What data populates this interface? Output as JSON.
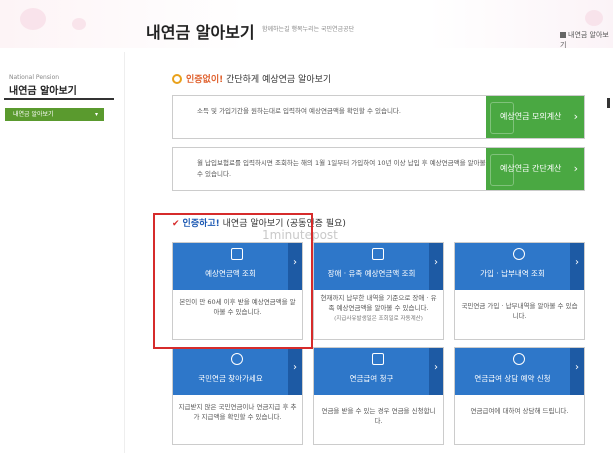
{
  "header": {
    "title": "내연금 알아보기",
    "subtitle": "함께하는길 행복누리는 국민연금공단",
    "util_link": "내연금 알아보기"
  },
  "sidebar": {
    "eng_label": "National Pension",
    "title": "내연금 알아보기",
    "menu_button": "내연금 알아보기"
  },
  "section_no_auth": {
    "heading_strong": "인증없이!",
    "heading_rest": " 간단하게 예상연금 알아보기",
    "rows": [
      {
        "text": "소득 및 가입기간을 원하는대로 입력하여 예상연금액을 확인할 수 있습니다.",
        "button": "예상연금 모의계산"
      },
      {
        "text": "월 납입보험료를 입력하시면 조회하는 해의 1월 1일부터 가입하여 10년 이상 납입 후 예상연금액을 알아볼 수 있습니다.",
        "button": "예상연금 간단계산"
      }
    ]
  },
  "section_auth": {
    "heading_strong": "인증하고!",
    "heading_rest": " 내연금 알아보기 (공동인증 필요)",
    "watermark": "1minutepost",
    "cards": [
      {
        "title": "예상연금액 조회",
        "desc": "본인이 만 60세 이후 받을 예상연금액을 알아볼 수 있습니다.",
        "note": ""
      },
      {
        "title": "장애 · 유족 예상연금액 조회",
        "desc": "현재까지 납부한 내역을 기준으로 장애 · 유족 예상연금액을 알아볼 수 있습니다.",
        "note": "(지급사유발생일은 조회일로 자동계산)"
      },
      {
        "title": "가입 · 납부내역 조회",
        "desc": "국민연금 가입 · 납부내역을 알아볼 수 있습니다.",
        "note": ""
      },
      {
        "title": "국민연금 찾아가세요",
        "desc": "지급받지 않은 국민연금이나 연금지급 후 추가 지급액을 확인할 수 있습니다.",
        "note": ""
      },
      {
        "title": "연금급여 청구",
        "desc": "연금을 받을 수 있는 경우 연금을 신청합니다.",
        "note": ""
      },
      {
        "title": "연금급여 상담 예약 신청",
        "desc": "연금급여에 대하여 상담해 드립니다.",
        "note": ""
      }
    ]
  },
  "colors": {
    "green_button": "#4aa842",
    "card_header": "#2e77c9",
    "highlight": "#d62b2b"
  }
}
